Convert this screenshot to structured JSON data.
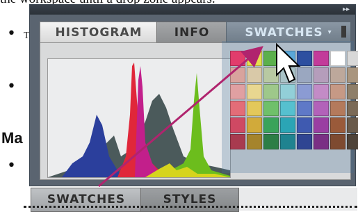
{
  "document": {
    "top_text": "the workspace until a drop zone appears.",
    "heading": "Ma",
    "bullets": [
      "•",
      "•",
      "•"
    ],
    "bullet_peek": "T"
  },
  "panel": {
    "collapse_icon": "double-chevron-right-icon",
    "tabs": [
      {
        "label": "HISTOGRAM",
        "state": "active"
      },
      {
        "label": "INFO",
        "state": "inactive"
      },
      {
        "label": "SWATCHES",
        "state": "dragging"
      }
    ],
    "tab_menu_icon": "panel-menu-icon"
  },
  "bottom_tabs": [
    {
      "label": "SWATCHES"
    },
    {
      "label": "STYLES"
    }
  ],
  "swatch_colors": [
    "#e23d6c",
    "#e6e04f",
    "#5bb04c",
    "#5aa7d8",
    "#2d4fa0",
    "#c23b9a",
    "#ffffff",
    "#d8d8d8",
    "#d8a39d",
    "#d9c9a8",
    "#b8c9a2",
    "#a9c3c7",
    "#9aa7c0",
    "#b59dbb",
    "#bda89b",
    "#a9957e",
    "#e0a0a2",
    "#e8d790",
    "#9ec88a",
    "#92cfd8",
    "#8b9bd3",
    "#c38bc6",
    "#c69985",
    "#8e7e68",
    "#e36d78",
    "#e3c85a",
    "#6fc06a",
    "#56c0cf",
    "#5f79c7",
    "#b262b9",
    "#b47a5c",
    "#7b6a57",
    "#cf4963",
    "#d1aa3a",
    "#3aa35a",
    "#2ba5b5",
    "#3f5ab0",
    "#9a3ea2",
    "#9a5a3a",
    "#6a5a4a",
    "#a83a4f",
    "#a5842c",
    "#2c7e46",
    "#1f8390",
    "#2f4592",
    "#7a2f84",
    "#7e4a30",
    "#4e4238"
  ],
  "colors": {
    "panel_bg": "#5a6470",
    "histogram_red": "#e0273a",
    "histogram_green": "#6cbd1d",
    "histogram_blue": "#2b3f9c",
    "drag_arrow": "#b0246e"
  },
  "cursor_icon": "arrow-cursor-icon",
  "drag_arrow_icon": "drag-direction-arrow-icon"
}
